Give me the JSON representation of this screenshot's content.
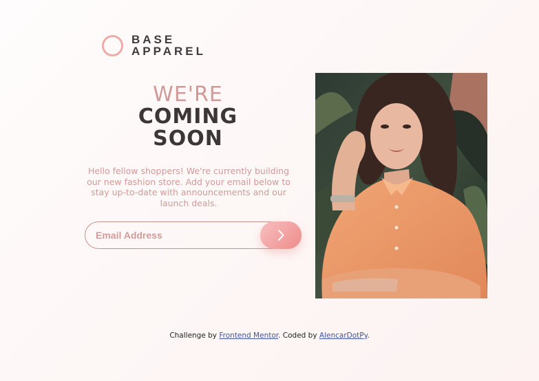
{
  "logo": {
    "line1": "BASE",
    "line2": "APPAREL"
  },
  "headline": {
    "light": "WE'RE",
    "line2": "COMING",
    "line3": "SOON"
  },
  "description": "Hello fellow shoppers! We're currently building our new fashion store. Add your email below to stay up-to-date with announcements and our launch deals.",
  "form": {
    "email_placeholder": "Email Address",
    "submit_icon": "chevron-right-icon"
  },
  "footer": {
    "prefix": "Challenge by ",
    "link1": "Frontend Mentor",
    "middle": ". Coded by ",
    "link2": "AlencarDotPy",
    "suffix": "."
  },
  "colors": {
    "accent": "#f0aaa8",
    "text_rose": "#cf9a98",
    "text_dark": "#3c3637",
    "button_from": "#f8bfbf",
    "button_to": "#ee8c8b"
  }
}
